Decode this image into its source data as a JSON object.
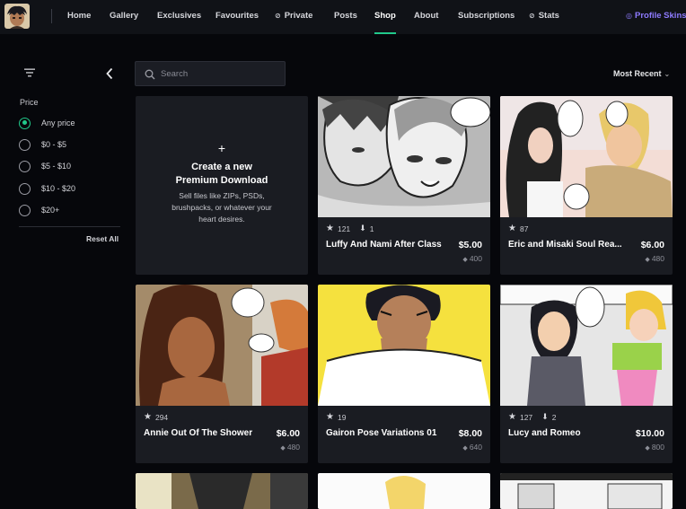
{
  "nav": {
    "items": [
      {
        "label": "Home"
      },
      {
        "label": "Gallery"
      },
      {
        "label": "Exclusives"
      },
      {
        "label": "Favourites"
      },
      {
        "label": "Private",
        "icon": "eye-slash-icon"
      },
      {
        "label": "Posts"
      },
      {
        "label": "Shop",
        "active": true
      },
      {
        "label": "About"
      },
      {
        "label": "Subscriptions"
      },
      {
        "label": "Stats",
        "icon": "eye-slash-icon"
      }
    ],
    "profile_skins": "Profile Skins",
    "accent": "#21c98b",
    "skins_color": "#8e7bff"
  },
  "sidebar": {
    "price_heading": "Price",
    "options": [
      {
        "label": "Any price",
        "selected": true
      },
      {
        "label": "$0 - $5"
      },
      {
        "label": "$5 - $10"
      },
      {
        "label": "$10 - $20"
      },
      {
        "label": "$20+"
      }
    ],
    "reset_label": "Reset All"
  },
  "search": {
    "placeholder": "Search",
    "value": ""
  },
  "sort": {
    "label": "Most Recent"
  },
  "create": {
    "plus": "+",
    "title_line1": "Create a new",
    "title_line2": "Premium Download",
    "desc": "Sell files like ZIPs, PSDs, brushpacks, or whatever your heart desires."
  },
  "cards": [
    {
      "title": "Luffy And Nami After Class",
      "price": "$5.00",
      "points": "400",
      "stars": "121",
      "downloads": "1"
    },
    {
      "title": "Eric and Misaki Soul Rea...",
      "price": "$6.00",
      "points": "480",
      "stars": "87"
    },
    {
      "title": "Annie Out Of The Shower",
      "price": "$6.00",
      "points": "480",
      "stars": "294"
    },
    {
      "title": "Gairon Pose Variations 01",
      "price": "$8.00",
      "points": "640",
      "stars": "19"
    },
    {
      "title": "Lucy and Romeo",
      "price": "$10.00",
      "points": "800",
      "stars": "127",
      "downloads": "2"
    }
  ]
}
